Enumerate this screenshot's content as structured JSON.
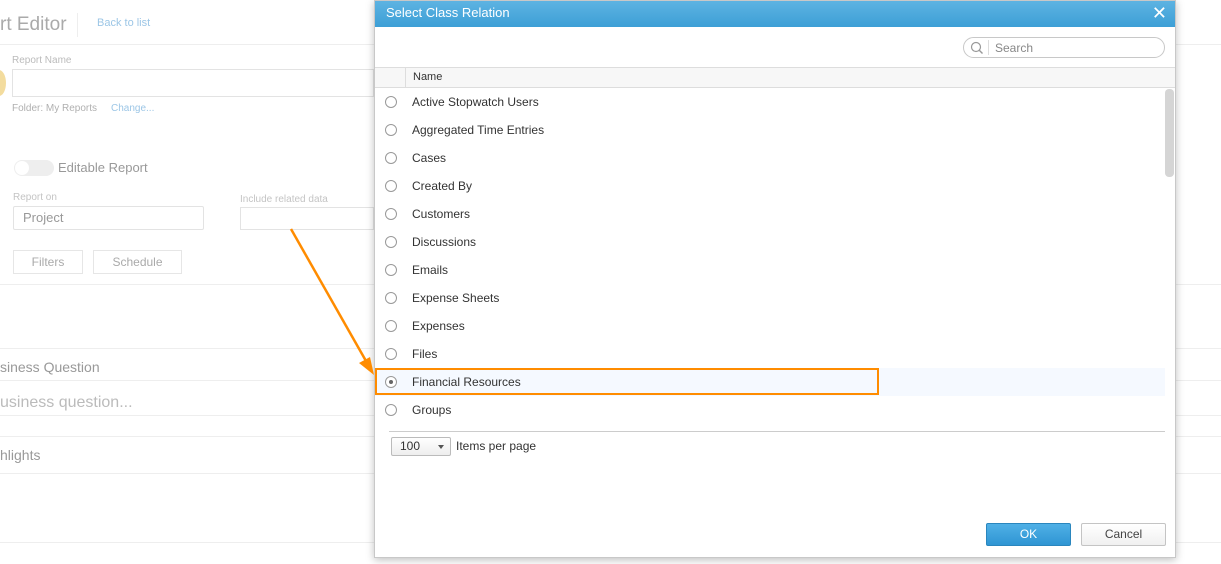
{
  "background": {
    "title": "rt Editor",
    "back_link": "Back to list",
    "report_name_label": "Report Name",
    "folder_text": "Folder: My Reports",
    "change_link": "Change...",
    "editable_label": "Editable Report",
    "report_on_label": "Report on",
    "report_on_value": "Project",
    "include_label": "Include related data",
    "filters_btn": "Filters",
    "schedule_btn": "Schedule",
    "business_question_title": "siness Question",
    "business_question_placeholder": "usiness question...",
    "highlights": "hlights"
  },
  "dialog": {
    "title": "Select Class Relation",
    "search_placeholder": "Search",
    "column_name": "Name",
    "items": [
      {
        "label": "Active Stopwatch Users",
        "selected": false
      },
      {
        "label": "Aggregated Time Entries",
        "selected": false
      },
      {
        "label": "Cases",
        "selected": false
      },
      {
        "label": "Created By",
        "selected": false
      },
      {
        "label": "Customers",
        "selected": false
      },
      {
        "label": "Discussions",
        "selected": false
      },
      {
        "label": "Emails",
        "selected": false
      },
      {
        "label": "Expense Sheets",
        "selected": false
      },
      {
        "label": "Expenses",
        "selected": false
      },
      {
        "label": "Files",
        "selected": false
      },
      {
        "label": "Financial Resources",
        "selected": true
      },
      {
        "label": "Groups",
        "selected": false
      }
    ],
    "page_size": "100",
    "items_per_page": "Items per page",
    "ok": "OK",
    "cancel": "Cancel"
  },
  "colors": {
    "accent": "#3d9fd6",
    "annotation": "#ff8c00"
  }
}
